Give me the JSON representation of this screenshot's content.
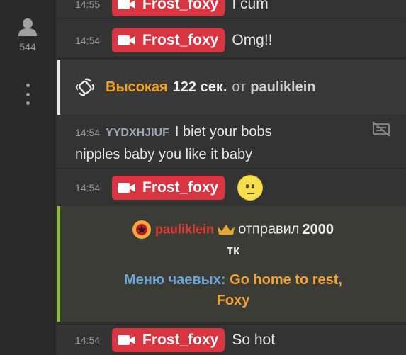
{
  "sidebar": {
    "viewer_count": "544",
    "icons": [
      "user-icon",
      "more-vertical-icon"
    ]
  },
  "colors": {
    "badge": "#d9343f",
    "level": "#f3a324",
    "tip_user": "#e23a33",
    "menu_label": "#6fa6d8",
    "menu_value": "#f0a43a",
    "tip_accent": "#88bd3a"
  },
  "messages": [
    {
      "time": "14:55",
      "user": "Frost_foxy",
      "text": "I cum"
    },
    {
      "time": "14:54",
      "user": "Frost_foxy",
      "text": "Omg!!"
    },
    {
      "icon": "vibration-icon",
      "level": "Высокая",
      "duration": "122 сек.",
      "from_word": "от",
      "user": "pauliklein"
    },
    {
      "time": "14:54",
      "user": "YYDXHJIUF",
      "text": "I biet your bobs",
      "text2": "nipples baby you like it baby"
    },
    {
      "time": "14:54",
      "user": "Frost_foxy",
      "emoji": "slightly-smiling-face"
    },
    {
      "user": "pauliklein",
      "action": "отправил",
      "amount": "2000",
      "unit": "тк",
      "menu_label": "Меню чаевых:",
      "menu_value_line1": "Go home to rest,",
      "menu_value_line2": "Foxy"
    },
    {
      "time": "14:54",
      "user": "Frost_foxy",
      "text": "So hot"
    }
  ]
}
